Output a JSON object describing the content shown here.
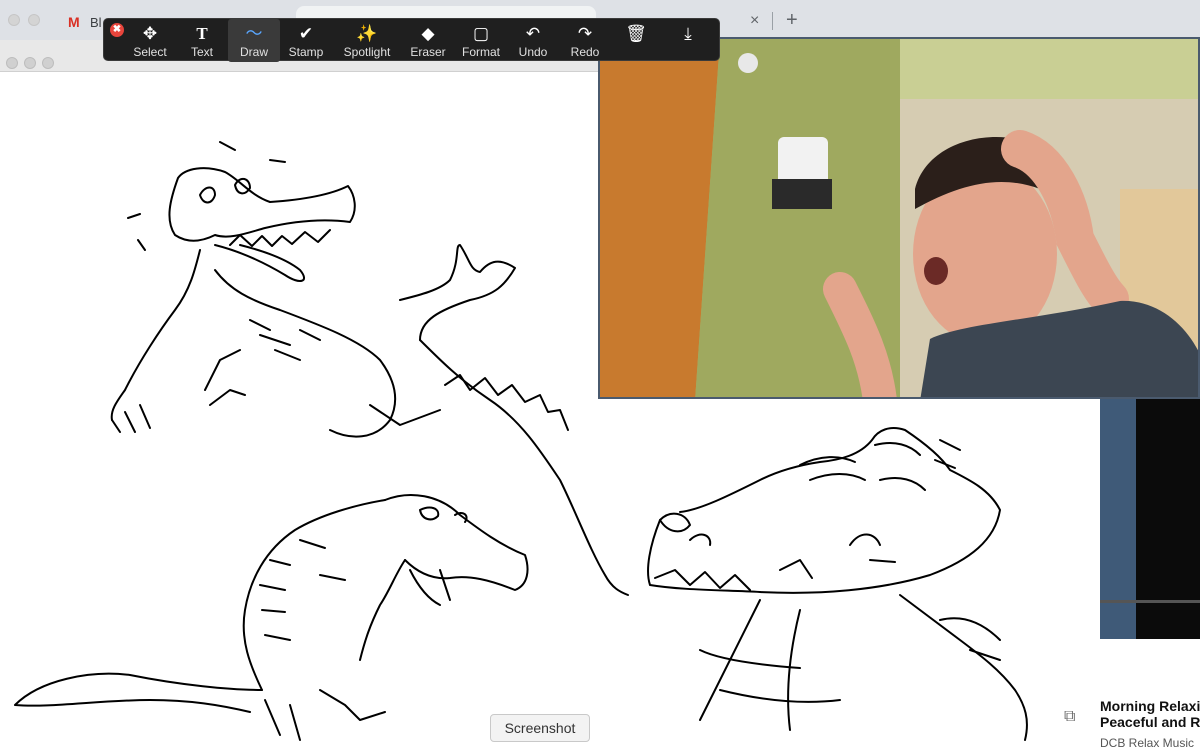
{
  "browser": {
    "tab_gmail_title": "Bl",
    "new_tab_symbol": "+",
    "close_symbol": "×"
  },
  "toolbar": {
    "close_symbol": "✖",
    "tools": [
      {
        "label": "Select",
        "icon": "move-icon",
        "glyph": "✥"
      },
      {
        "label": "Text",
        "icon": "text-icon",
        "glyph": "T"
      },
      {
        "label": "Draw",
        "icon": "draw-icon",
        "glyph": "〜",
        "active": true
      },
      {
        "label": "Stamp",
        "icon": "stamp-check-icon",
        "glyph": "✔"
      },
      {
        "label": "Spotlight",
        "icon": "spotlight-wand-icon",
        "glyph": "✨"
      },
      {
        "label": "Eraser",
        "icon": "eraser-icon",
        "glyph": "◆"
      },
      {
        "label": "Format",
        "icon": "format-icon",
        "glyph": "▢"
      },
      {
        "label": "Undo",
        "icon": "undo-icon",
        "glyph": "↶"
      },
      {
        "label": "Redo",
        "icon": "redo-icon",
        "glyph": "↷"
      },
      {
        "label": "",
        "icon": "trash-icon",
        "glyph": "🗑"
      },
      {
        "label": "",
        "icon": "save-icon",
        "glyph": "⤓"
      }
    ]
  },
  "side_video": {
    "title": "Morning Relaxing Peaceful and Rel",
    "title_line1": "Morning Relaxinc",
    "title_line2": "Peaceful and Rel",
    "channel": "DCB Relax Music"
  },
  "screenshot_button": "Screenshot",
  "colors": {
    "toolbar_bg": "#1f1f1f",
    "active_tool_accent": "#5aa7ff",
    "close_red": "#e8453c",
    "video_border": "#4a5a6e"
  }
}
